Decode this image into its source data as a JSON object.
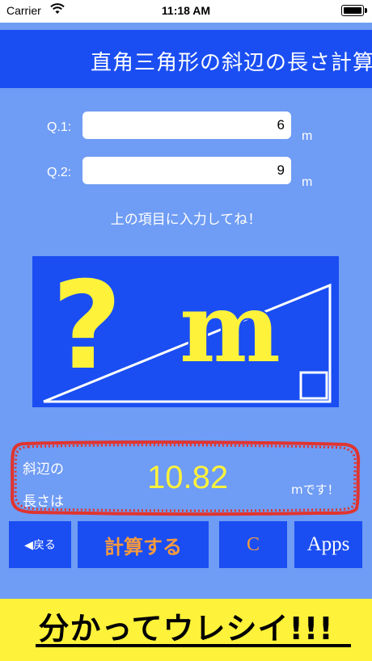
{
  "status_bar": {
    "carrier": "Carrier",
    "time": "11:18 AM",
    "icons": [
      "wifi-icon",
      "battery-icon"
    ]
  },
  "header": {
    "title": "直角三角形の斜辺の長さ計算"
  },
  "form": {
    "q1": {
      "label": "Q.1:",
      "value": "6",
      "unit": "m"
    },
    "q2": {
      "label": "Q.2:",
      "value": "9",
      "unit": "m"
    },
    "hint": "上の項目に入力してね！"
  },
  "illustration": {
    "question_mark": "?",
    "unit_text": "m"
  },
  "result": {
    "label_line1": "斜辺の",
    "label_line2": "長さは",
    "value": "10.82",
    "unit": "mです！",
    "highlight_color": "#e0342f"
  },
  "buttons": {
    "back": "◀戻る",
    "calculate": "計算する",
    "clear": "C",
    "apps": "Apps"
  },
  "banner": {
    "text": "分かってウレシイ!!!"
  },
  "colors": {
    "background": "#6f9cf4",
    "accent": "#1a4ef2",
    "yellow": "#fff23a",
    "orange": "#f79a3e"
  }
}
